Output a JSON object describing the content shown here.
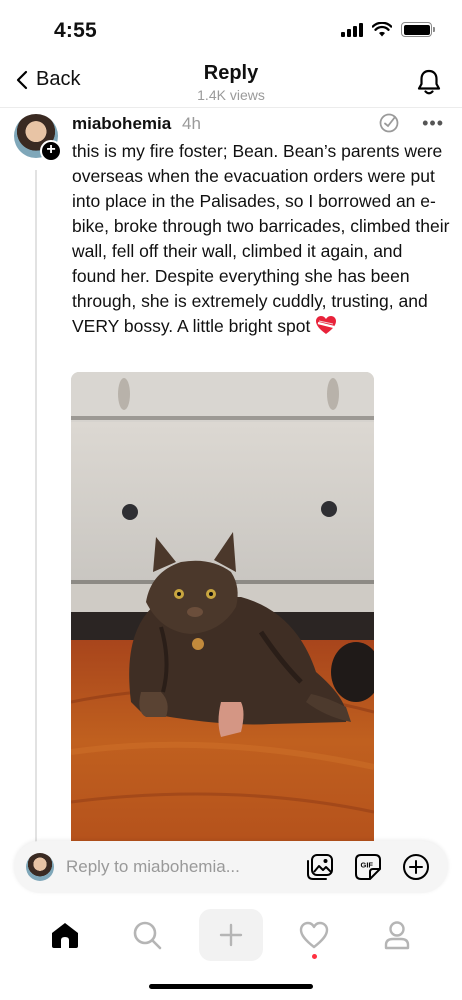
{
  "status_bar": {
    "time": "4:55"
  },
  "header": {
    "back_label": "Back",
    "title": "Reply",
    "subtitle": "1.4K views"
  },
  "post": {
    "username": "miabohemia",
    "time": "4h",
    "text": "this is my fire foster; Bean. Bean’s parents were overseas when the evacuation orders were put into place in the Palisades, so I borrowed an e-bike, broke through two barricades, climbed their wall, fell off their wall, climbed it again, and found her. Despite everything she has been through, she is extremely cuddly, trusting, and VERY bossy. A little bright spot"
  },
  "reply": {
    "placeholder": "Reply to miabohemia..."
  },
  "icons": {
    "back": "chevron-left-icon",
    "bell": "bell-icon",
    "plus_badge": "plus-icon",
    "feed_check": "check-circle-icon",
    "more": "more-icon",
    "gallery": "image-gallery-icon",
    "gif": "gif-icon",
    "add": "plus-circle-icon",
    "home": "home-icon",
    "search": "search-icon",
    "create": "plus-icon",
    "activity": "heart-icon",
    "profile": "profile-icon"
  },
  "colors": {
    "accent": "#000000",
    "secondary_text": "#9a9a9a",
    "notification_dot": "#ff3040"
  }
}
